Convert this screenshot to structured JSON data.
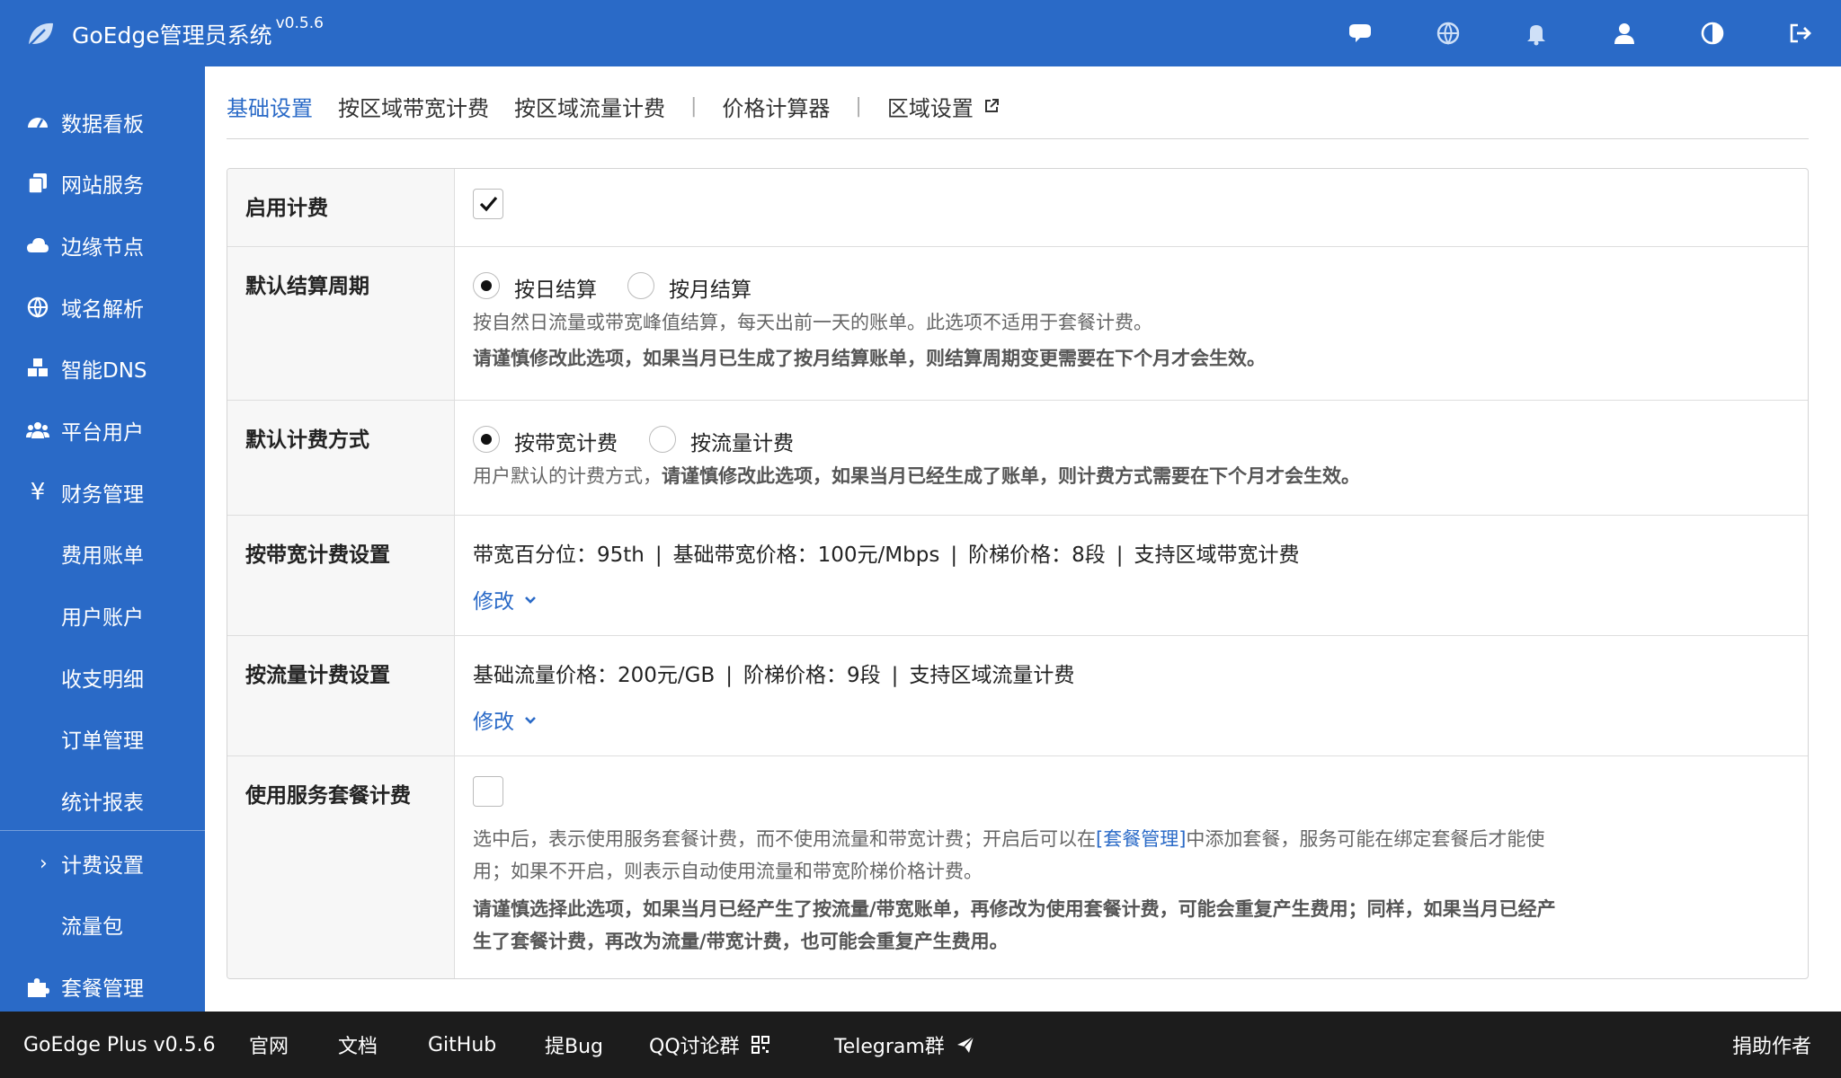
{
  "header": {
    "title": "GoEdge管理员系统",
    "version": "v0.5.6"
  },
  "sidebar": {
    "items": [
      {
        "label": "数据看板",
        "icon": "dashboard-icon"
      },
      {
        "label": "网站服务",
        "icon": "copy-icon"
      },
      {
        "label": "边缘节点",
        "icon": "cloud-icon"
      },
      {
        "label": "域名解析",
        "icon": "globe-icon"
      },
      {
        "label": "智能DNS",
        "icon": "cubes-icon"
      },
      {
        "label": "平台用户",
        "icon": "users-icon"
      },
      {
        "label": "财务管理",
        "icon": "yen-icon"
      },
      {
        "label": "费用账单"
      },
      {
        "label": "用户账户"
      },
      {
        "label": "收支明细"
      },
      {
        "label": "订单管理"
      },
      {
        "label": "统计报表"
      },
      {
        "label": "计费设置"
      },
      {
        "label": "流量包"
      },
      {
        "label": "套餐管理",
        "icon": "puzzle-icon"
      }
    ]
  },
  "tabs": {
    "t1": "基础设置",
    "t2": "按区域带宽计费",
    "t3": "按区域流量计费",
    "t4": "价格计算器",
    "t5": "区域设置",
    "sep": "|"
  },
  "form": {
    "enable": {
      "label": "启用计费"
    },
    "period": {
      "label": "默认结算周期",
      "opt1": "按日结算",
      "opt2": "按月结算",
      "desc1": "按自然日流量或带宽峰值结算，每天出前一天的账单。此选项不适用于套餐计费。",
      "desc2": "请谨慎修改此选项，如果当月已生成了按月结算账单，则结算周期变更需要在下个月才会生效。"
    },
    "method": {
      "label": "默认计费方式",
      "opt1": "按带宽计费",
      "opt2": "按流量计费",
      "desc_a": "用户默认的计费方式，",
      "desc_b": "请谨慎修改此选项，如果当月已经生成了账单，则计费方式需要在下个月才会生效。"
    },
    "bandwidth": {
      "label": "按带宽计费设置",
      "p1": "带宽百分位：95th",
      "p2": "基础带宽价格：100元/Mbps",
      "p3": "阶梯价格：8段",
      "p4": "支持区域带宽计费",
      "edit": "修改"
    },
    "traffic": {
      "label": "按流量计费设置",
      "p1": "基础流量价格：200元/GB",
      "p2": "阶梯价格：9段",
      "p3": "支持区域流量计费",
      "edit": "修改"
    },
    "plan": {
      "label": "使用服务套餐计费",
      "desc_a": "选中后，表示使用服务套餐计费，而不使用流量和带宽计费；开启后可以在",
      "desc_link": "[套餐管理]",
      "desc_b": "中添加套餐，服务可能在绑定套餐后才能使",
      "desc_c": "用；如果不开启，则表示自动使用流量和带宽阶梯价格计费。",
      "warn1": "请谨慎选择此选项，如果当月已经产生了按流量/带宽账单，再修改为使用套餐计费，可能会重复产生费用；同样，如果当月已经产",
      "warn2": "生了套餐计费，再改为流量/带宽计费，也可能会重复产生费用。"
    }
  },
  "footer": {
    "version": "GoEdge Plus v0.5.6",
    "site": "官网",
    "docs": "文档",
    "github": "GitHub",
    "bug": "提Bug",
    "qq": "QQ讨论群",
    "telegram": "Telegram群",
    "donate": "捐助作者"
  },
  "colors": {
    "brand": "#2a6ac7",
    "footer": "#1c1c1c"
  }
}
